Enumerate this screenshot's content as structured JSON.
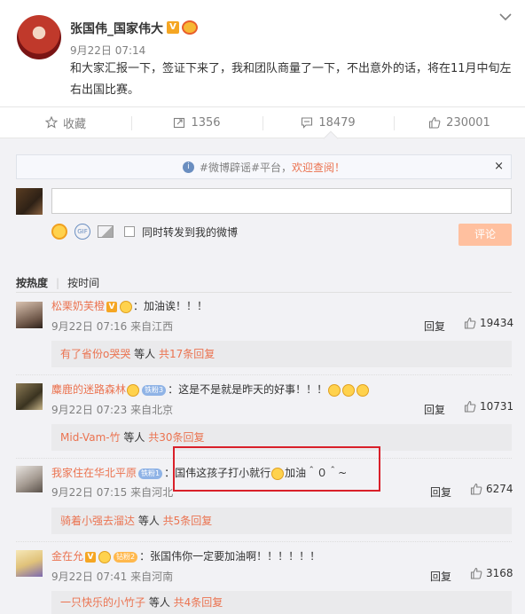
{
  "post": {
    "username": "张国伟_国家伟大",
    "verified_badge": "V",
    "date": "9月22日 07:14",
    "text": "和大家汇报一下，签证下来了，我和团队商量了一下，不出意外的话，将在11月中旬左右出国比赛。",
    "menu_icon": "chevron-down-icon"
  },
  "actions": {
    "favorite_label": "收藏",
    "repost_count": "1356",
    "comment_count": "18479",
    "like_count": "230001"
  },
  "notice": {
    "info_icon": "i",
    "text": "#微博辟谣#平台，",
    "link": "欢迎查阅！",
    "close": "×"
  },
  "composer": {
    "input_value": "",
    "emoji_icon": "emoji-icon",
    "gif_label": "GIF",
    "image_icon": "image-icon",
    "repost_checkbox_label": "同时转发到我的微博",
    "submit_label": "评论"
  },
  "sort": {
    "by_hot": "按热度",
    "separator": "|",
    "by_time": "按时间"
  },
  "comments": [
    {
      "name": "松栗奶芙橙",
      "has_v": true,
      "fan_badge": "",
      "text": "：加油诶！！！",
      "meta": "9月22日 07:16 来自江西",
      "reply": "回复",
      "likes": "19434",
      "sub_user": "有了省份o哭哭",
      "sub_mid": " 等人 ",
      "sub_count": "共17条回复"
    },
    {
      "name": "麋鹿的迷路森林",
      "has_v": false,
      "fan_badge": "铁粉3",
      "text": "：这是不是就是昨天的好事！！！",
      "meta": "9月22日 07:23 来自北京",
      "reply": "回复",
      "likes": "10731",
      "sub_user": "Mid-Vam-竹",
      "sub_mid": " 等人 ",
      "sub_count": "共30条回复"
    },
    {
      "name": "我家住在华北平原",
      "has_v": false,
      "fan_badge": "铁粉1",
      "text": "：国伟这孩子打小就行",
      "text2": "加油＾０＾~",
      "meta": "9月22日 07:15 来自河北",
      "reply": "回复",
      "likes": "6274",
      "sub_user": "骑着小强去溜达",
      "sub_mid": " 等人 ",
      "sub_count": "共5条回复"
    },
    {
      "name": "金在允",
      "has_v": true,
      "fan_badge": "钻粉2",
      "text": "：张国伟你一定要加油啊！！！！！！",
      "meta": "9月22日 07:41 来自河南",
      "reply": "回复",
      "likes": "3168",
      "sub_user": "一只快乐的小竹子",
      "sub_mid": " 等人 ",
      "sub_count": "共4条回复"
    }
  ],
  "colors": {
    "accent": "#eb7350",
    "highlight_box": "#d9202a",
    "background": "#f2f2f5"
  }
}
